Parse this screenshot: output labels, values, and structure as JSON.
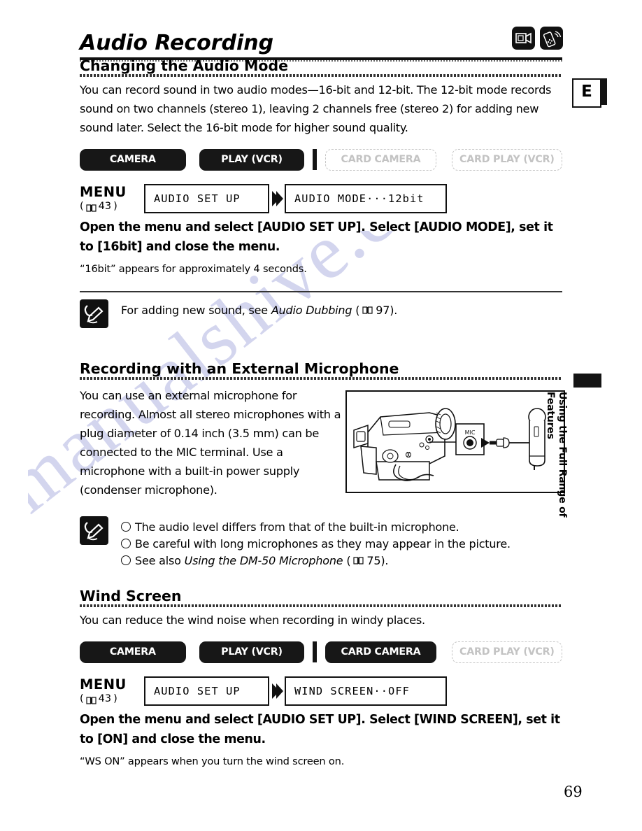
{
  "page": {
    "title": "Audio Recording",
    "page_number": "69",
    "language_tab": "E",
    "side_tab_text": "Using the Full Range of Features",
    "watermark": "manualshive.com",
    "header_icons": [
      "camcorder-icon",
      "remote-control-icon"
    ]
  },
  "sections": [
    {
      "heading": "Changing the Audio Mode",
      "intro": "You can record sound in two audio modes—16-bit and 12-bit. The 12-bit mode records sound on two channels (stereo 1), leaving 2 channels free (stereo 2) for adding new sound later. Select the 16-bit mode for higher sound quality.",
      "modes": [
        {
          "label": "CAMERA",
          "enabled": true
        },
        {
          "label": "PLAY (VCR)",
          "enabled": true
        },
        {
          "label": "CARD CAMERA",
          "enabled": false
        },
        {
          "label": "CARD PLAY (VCR)",
          "enabled": false
        }
      ],
      "menu": {
        "label": "MENU",
        "reference": "43",
        "box1": "AUDIO SET UP",
        "box2": "AUDIO MODE···12bit"
      },
      "instruction": "Open the menu and select [AUDIO SET UP]. Select [AUDIO MODE], set it to [16bit] and close the menu.",
      "note_small": "“16bit” appears for approximately 4 seconds.",
      "callout": {
        "text_before": "For adding new sound, see ",
        "text_italic": "Audio Dubbing",
        "text_after": " (",
        "page_ref": "97",
        "text_end": ")."
      }
    },
    {
      "heading": "Recording with an External Microphone",
      "intro": "You can use an external microphone for recording. Almost all stereo microphones with a plug diameter of 0.14 inch (3.5 mm) can be connected to the MIC terminal. Use a microphone with a built-in power supply (condenser microphone).",
      "figure": {
        "name": "camcorder-mic-connection-diagram",
        "terminal_label": "MIC"
      },
      "bullets": [
        {
          "text": "The audio level differs from that of the built-in microphone."
        },
        {
          "text": "Be careful with long microphones as they may appear in the picture."
        },
        {
          "text_before": "See also ",
          "text_italic": "Using the DM-50 Microphone",
          "text_after": " (",
          "page_ref": "75",
          "text_end": ")."
        }
      ]
    },
    {
      "heading": "Wind Screen",
      "intro": "You can reduce the wind noise when recording in windy places.",
      "modes": [
        {
          "label": "CAMERA",
          "enabled": true
        },
        {
          "label": "PLAY (VCR)",
          "enabled": true
        },
        {
          "label": "CARD CAMERA",
          "enabled": true
        },
        {
          "label": "CARD PLAY (VCR)",
          "enabled": false
        }
      ],
      "menu": {
        "label": "MENU",
        "reference": "43",
        "box1": "AUDIO SET UP",
        "box2": "WIND SCREEN··OFF"
      },
      "instruction": "Open the menu and select [AUDIO SET UP]. Select [WIND SCREEN], set it to [ON] and close the menu.",
      "note_small": "“WS ON” appears when you turn the wind screen on."
    }
  ]
}
